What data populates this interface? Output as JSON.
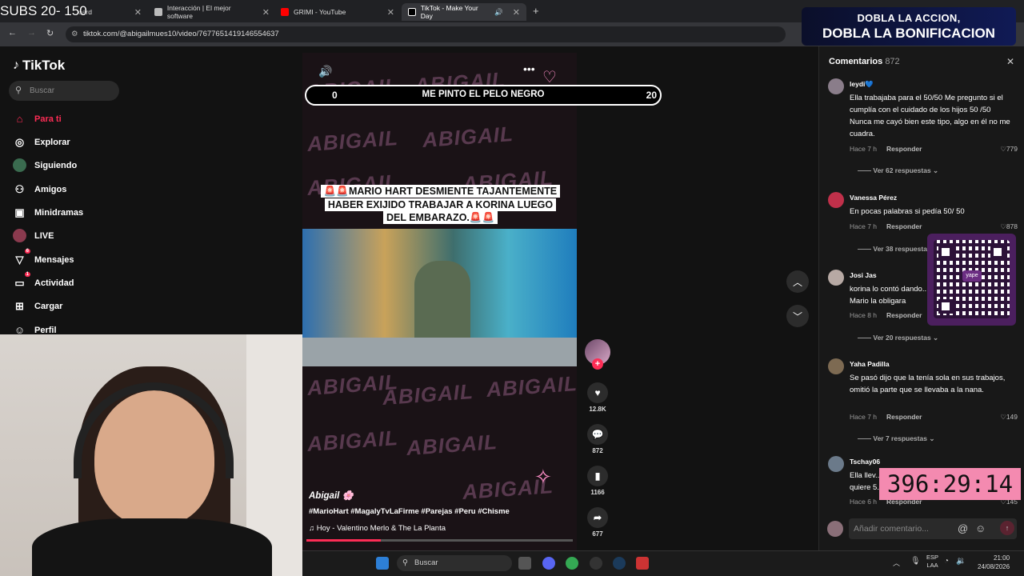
{
  "overlay": {
    "subs": "SUBS 20- 150"
  },
  "browser": {
    "tabs": [
      {
        "label": "oard",
        "favicon_color": "#888888"
      },
      {
        "label": "Interacción | El mejor software",
        "favicon_color": "#bbbbbb"
      },
      {
        "label": "GRIMI - YouTube",
        "favicon_color": "#ff0000"
      },
      {
        "label": "TikTok - Make Your Day",
        "favicon_color": "#ffffff"
      }
    ],
    "url": "tiktok.com/@abigailmues10/video/7677651419146554637"
  },
  "promo": {
    "line1": "DOBLA LA ACCION,",
    "line2": "DOBLA LA BONIFICACION"
  },
  "sidebar": {
    "logo": "TikTok",
    "search_placeholder": "Buscar",
    "items": [
      {
        "label": "Para ti",
        "icon": "home-icon",
        "active": true
      },
      {
        "label": "Explorar",
        "icon": "compass-icon"
      },
      {
        "label": "Siguiendo",
        "icon": "following-icon"
      },
      {
        "label": "Amigos",
        "icon": "friends-icon"
      },
      {
        "label": "Minidramas",
        "icon": "film-icon"
      },
      {
        "label": "LIVE",
        "icon": "live-icon"
      },
      {
        "label": "Mensajes",
        "icon": "send-icon",
        "badge": "6"
      },
      {
        "label": "Actividad",
        "icon": "inbox-icon",
        "badge": "1"
      },
      {
        "label": "Cargar",
        "icon": "plus-square-icon"
      },
      {
        "label": "Perfil",
        "icon": "profile-icon"
      }
    ]
  },
  "video": {
    "bar_left": "0",
    "bar_title": "ME PINTO EL PELO NEGRO",
    "bar_right": "20",
    "watermark": "ABIGAIL",
    "headline": "🚨🚨MARIO HART DESMIENTE TAJANTEMENTE HABER EXIJIDO TRABAJAR A KORINA LUEGO DEL EMBARAZO.🚨🚨",
    "author": "Abigail 🌸",
    "hashtags": "#MarioHart #MagalyTvLaFirme #Parejas #Peru #Chisme",
    "music": "Hoy - Valentino Merlo & The La Planta",
    "progress": 0.28
  },
  "actions": {
    "likes": "12.8K",
    "comments": "872",
    "saves": "1166",
    "shares": "677"
  },
  "comments_panel": {
    "title": "Comentarios",
    "count": "872",
    "items": [
      {
        "user": "leydi💙",
        "text": "Ella trabajaba para el 50/50 Me pregunto si el cumplía con el cuidado de los hijos 50 /50 Nunca me cayó bien este tipo, algo en él no me cuadra.",
        "time": "Hace 7 h",
        "reply": "Responder",
        "likes": "779",
        "replies": "Ver 62 respuestas",
        "avatar": "#8a7d8a"
      },
      {
        "user": "Vanessa Pérez",
        "text": "En pocas palabras si pedía 50/ 50",
        "time": "Hace 7 h",
        "reply": "Responder",
        "likes": "878",
        "replies": "Ver 38 respuestas",
        "avatar": "#c0304a"
      },
      {
        "user": "Josi Jas",
        "text": "korina lo contó dando... Mario la obligara",
        "time": "Hace 8 h",
        "reply": "Responder",
        "likes": "",
        "replies": "Ver 20 respuestas",
        "avatar": "#b7a9a4"
      },
      {
        "user": "Yaha Padilla",
        "text": "Se pasó dijo que la tenía sola en sus trabajos, omitió la parte que se llevaba a la nana.",
        "time": "Hace 7 h",
        "reply": "Responder",
        "likes": "149",
        "replies": "Ver 7 respuestas",
        "avatar": "#7d6a52"
      },
      {
        "user": "Tschay06",
        "text": "Ella llev... quiere 5...",
        "time": "Hace 6 h",
        "reply": "Responder",
        "likes": "145",
        "replies": "",
        "avatar": "#6b7a8a"
      }
    ],
    "input_placeholder": "Añadir comentario...",
    "at_symbol": "@",
    "emoji_icon": "☺"
  },
  "qr": {
    "brand": "yape"
  },
  "timer": "396:29:14",
  "taskbar": {
    "search": "Buscar",
    "lang_top": "ESP",
    "lang_bottom": "LAA",
    "time": "21:00",
    "date": "24/08/2026"
  }
}
